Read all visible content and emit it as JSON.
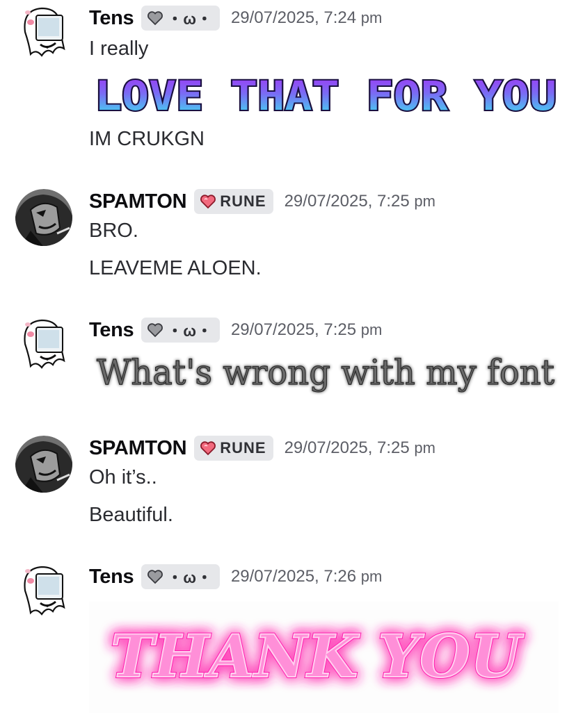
{
  "colors": {
    "username": "#0d0d10",
    "timestamp": "#5c5e66",
    "tag_bg": "#e6e7ea",
    "rune_heart": "#e8384f",
    "love_gradient_top": "#9b3cf5",
    "love_gradient_bottom": "#3fe6f2",
    "thank_pink": "#ff4fc0"
  },
  "messages": [
    {
      "author": "Tens",
      "tag_icon": "gray-heart-icon",
      "tag_text": "・ω・",
      "timestamp": "29/07/2025, 7:24",
      "timestamp_suffix": "pm",
      "lines": [
        "I really"
      ],
      "sticker_text": "LOVE THAT FOR YOU",
      "after_lines": [
        "IM CRUKGN"
      ]
    },
    {
      "author": "SPAMTON",
      "tag_icon": "red-heart-icon",
      "tag_text": "RUNE",
      "timestamp": "29/07/2025, 7:25",
      "timestamp_suffix": "pm",
      "lines": [
        "BRO.",
        "LEAVEME ALOEN."
      ]
    },
    {
      "author": "Tens",
      "tag_icon": "gray-heart-icon",
      "tag_text": "・ω・",
      "timestamp": "29/07/2025, 7:25",
      "timestamp_suffix": "pm",
      "sticker_text": "What's wrong with my font"
    },
    {
      "author": "SPAMTON",
      "tag_icon": "red-heart-icon",
      "tag_text": "RUNE",
      "timestamp": "29/07/2025, 7:25",
      "timestamp_suffix": "pm",
      "lines": [
        "Oh it’s..",
        "Beautiful."
      ]
    },
    {
      "author": "Tens",
      "tag_icon": "gray-heart-icon",
      "tag_text": "・ω・",
      "timestamp": "29/07/2025, 7:26",
      "timestamp_suffix": "pm",
      "sticker_text": "THANK YOU"
    }
  ]
}
